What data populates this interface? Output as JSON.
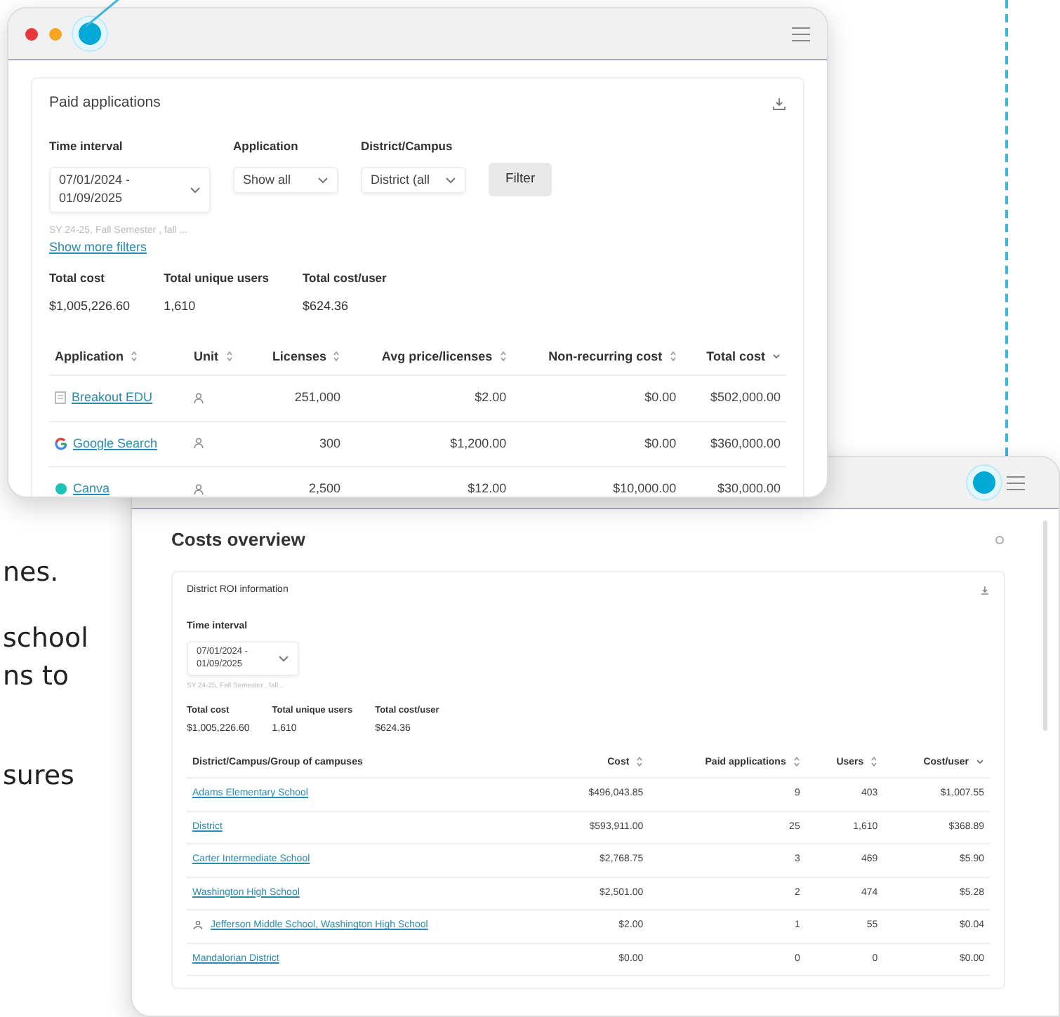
{
  "background_text": [
    "nes.",
    "school",
    "ns to",
    "sures"
  ],
  "window_1": {
    "card_title": "Paid applications",
    "filters": [
      {
        "label": "Time interval",
        "value": "07/01/2024 - 01/09/2025",
        "hint": "SY 24-25, Fall Semester , fall ..."
      },
      {
        "label": "Application",
        "value": "Show all"
      },
      {
        "label": "District/Campus",
        "value": "District (all"
      }
    ],
    "filter_button": "Filter",
    "more_filters_link": "Show more filters",
    "totals": [
      {
        "label": "Total cost",
        "value": "$1,005,226.60"
      },
      {
        "label": "Total unique users",
        "value": "1,610"
      },
      {
        "label": "Total cost/user",
        "value": "$624.36"
      }
    ],
    "table": {
      "columns": [
        {
          "label": "Application",
          "sortable": true,
          "sorted": false
        },
        {
          "label": "Unit",
          "sortable": true,
          "sorted": false
        },
        {
          "label": "Licenses",
          "sortable": true,
          "sorted": false
        },
        {
          "label": "Avg price/licenses",
          "sortable": true,
          "sorted": false
        },
        {
          "label": "Non-recurring cost",
          "sortable": true,
          "sorted": false
        },
        {
          "label": "Total cost",
          "sortable": true,
          "sorted": true
        }
      ],
      "rows": [
        {
          "name": "Breakout EDU",
          "kind": "document",
          "licenses": "251,000",
          "avg_price": "$2.00",
          "non_recurring": "$0.00",
          "total": "$502,000.00"
        },
        {
          "name": "Google Search",
          "kind": "google",
          "licenses": "300",
          "avg_price": "$1,200.00",
          "non_recurring": "$0.00",
          "total": "$360,000.00"
        },
        {
          "name": "Canva",
          "kind": "canva",
          "licenses": "2,500",
          "avg_price": "$12.00",
          "non_recurring": "$10,000.00",
          "total": "$30,000.00"
        }
      ]
    }
  },
  "window_2": {
    "title": "Costs overview",
    "card_title": "District ROI information",
    "filter": {
      "label": "Time interval",
      "value": "07/01/2024 - 01/09/2025",
      "hint": "SY 24-25, Fall Semester , fall..."
    },
    "totals": [
      {
        "label": "Total cost",
        "value": "$1,005,226.60"
      },
      {
        "label": "Total unique users",
        "value": "1,610"
      },
      {
        "label": "Total cost/user",
        "value": "$624.36"
      }
    ],
    "table": {
      "columns": [
        {
          "label": "District/Campus/Group of campuses",
          "sortable": false
        },
        {
          "label": "Cost",
          "sortable": true,
          "sorted": false
        },
        {
          "label": "Paid applications",
          "sortable": true,
          "sorted": false
        },
        {
          "label": "Users",
          "sortable": true,
          "sorted": false
        },
        {
          "label": "Cost/user",
          "sortable": true,
          "sorted": true
        }
      ],
      "rows": [
        {
          "name": "Adams Elementary School",
          "group": false,
          "cost": "$496,043.85",
          "apps": "9",
          "users": "403",
          "cost_per_user": "$1,007.55"
        },
        {
          "name": "District",
          "group": false,
          "cost": "$593,911.00",
          "apps": "25",
          "users": "1,610",
          "cost_per_user": "$368.89"
        },
        {
          "name": "Carter Intermediate School",
          "group": false,
          "cost": "$2,768.75",
          "apps": "3",
          "users": "469",
          "cost_per_user": "$5.90"
        },
        {
          "name": "Washington High School",
          "group": false,
          "cost": "$2,501.00",
          "apps": "2",
          "users": "474",
          "cost_per_user": "$5.28"
        },
        {
          "name": "Jefferson Middle School, Washington High School",
          "group": true,
          "cost": "$2.00",
          "apps": "1",
          "users": "55",
          "cost_per_user": "$0.04"
        },
        {
          "name": "Mandalorian District",
          "group": false,
          "cost": "$0.00",
          "apps": "0",
          "users": "0",
          "cost_per_user": "$0.00"
        }
      ]
    }
  }
}
